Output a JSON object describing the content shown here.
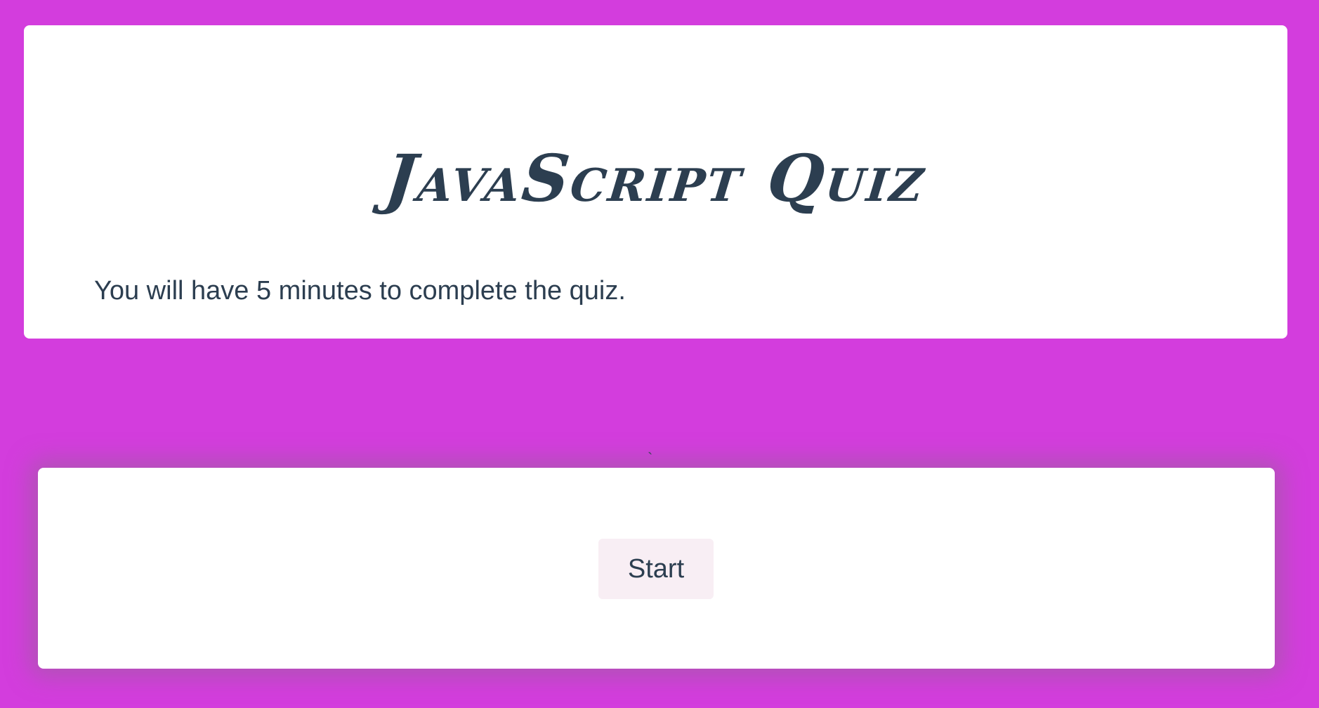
{
  "header": {
    "title": "JavaScript Quiz",
    "intro": "You will have 5 minutes to complete the quiz."
  },
  "stray_mark": "`",
  "start_card": {
    "start_label": "Start"
  },
  "colors": {
    "page_background": "#d33ddd",
    "card_background": "#ffffff",
    "text": "#2c3e50",
    "button_background": "#f8eef4"
  }
}
